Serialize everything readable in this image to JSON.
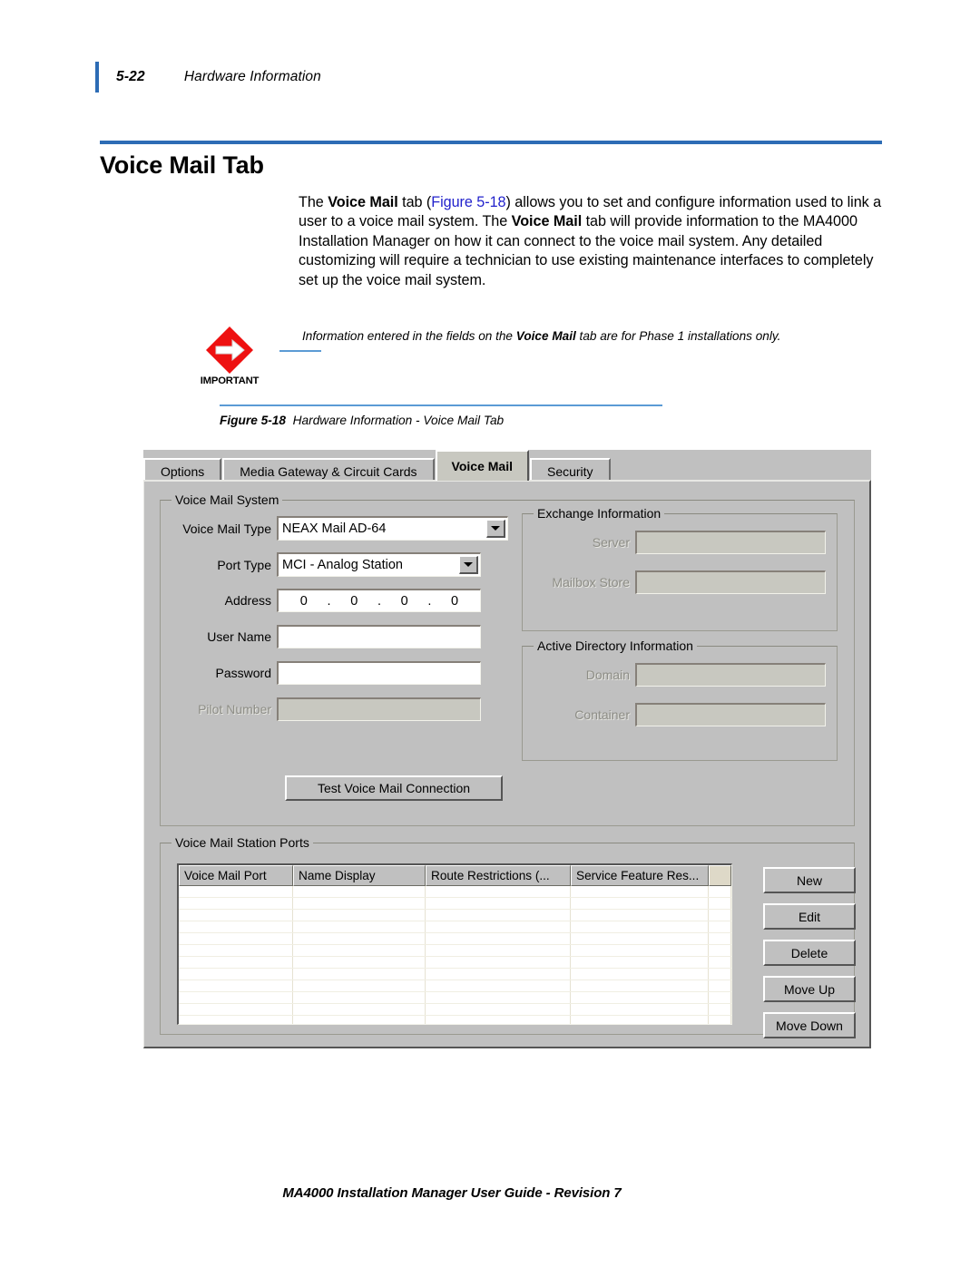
{
  "header": {
    "page_number": "5-22",
    "chapter_title": "Hardware Information"
  },
  "heading": {
    "title": "Voice Mail Tab"
  },
  "body": {
    "paragraph_parts": {
      "p1": "The ",
      "b1": "Voice Mail",
      "p2": " tab (",
      "xref": "Figure 5-18",
      "p3": ") allows you to set and configure information used to link a user to a voice mail system. The ",
      "b2": "Voice Mail",
      "p4": " tab will provide information to the MA4000 Installation Manager on how it can connect to the voice mail system. Any detailed customizing will require a technician to use existing maintenance interfaces to completely set up the voice mail system."
    }
  },
  "note": {
    "icon_label": "IMPORTANT",
    "text_parts": {
      "t1": "Information entered in the fields on the ",
      "b1": "Voice Mail",
      "t2": " tab are for Phase 1 installations only."
    }
  },
  "figure": {
    "label": "Figure 5-18",
    "caption": "Hardware Information - Voice Mail Tab"
  },
  "dialog": {
    "tabs": [
      {
        "label": "Options",
        "active": false
      },
      {
        "label": "Media Gateway & Circuit Cards",
        "active": false
      },
      {
        "label": "Voice Mail",
        "active": true
      },
      {
        "label": "Security",
        "active": false
      }
    ],
    "voice_mail_system": {
      "group_title": "Voice Mail System",
      "voice_mail_type": {
        "label": "Voice Mail Type",
        "value": "NEAX Mail AD-64"
      },
      "port_type": {
        "label": "Port Type",
        "value": "MCI - Analog Station"
      },
      "address": {
        "label": "Address",
        "octets": [
          "0",
          "0",
          "0",
          "0"
        ],
        "separator": "."
      },
      "user_name": {
        "label": "User Name",
        "value": "",
        "enabled": true
      },
      "password": {
        "label": "Password",
        "value": "",
        "enabled": true
      },
      "pilot_number": {
        "label": "Pilot Number",
        "value": "",
        "enabled": false
      },
      "test_button": "Test Voice Mail Connection"
    },
    "exchange_information": {
      "group_title": "Exchange Information",
      "server": {
        "label": "Server",
        "value": "",
        "enabled": false
      },
      "mailbox_store": {
        "label": "Mailbox Store",
        "value": "",
        "enabled": false
      }
    },
    "active_directory_information": {
      "group_title": "Active Directory Information",
      "domain": {
        "label": "Domain",
        "value": "",
        "enabled": false
      },
      "container": {
        "label": "Container",
        "value": "",
        "enabled": false
      }
    },
    "station_ports": {
      "group_title": "Voice Mail Station Ports",
      "columns": [
        "Voice Mail Port",
        "Name Display",
        "Route Restrictions (...",
        "Service Feature Res..."
      ],
      "row_count": 12,
      "rows": [],
      "buttons": [
        "New",
        "Edit",
        "Delete",
        "Move Up",
        "Move Down"
      ]
    },
    "colors": {
      "face": "#c0c0c0",
      "field": "#ffffff",
      "disabled_text": "#8d8d86"
    }
  },
  "footer": {
    "text": "MA4000 Installation Manager User Guide - Revision 7"
  },
  "accent_colors": {
    "heading_rule": "#2d6cb5",
    "caption_rule": "#5b9bd5",
    "xref_link": "#2222cc",
    "note_icon": "#ee1111"
  }
}
